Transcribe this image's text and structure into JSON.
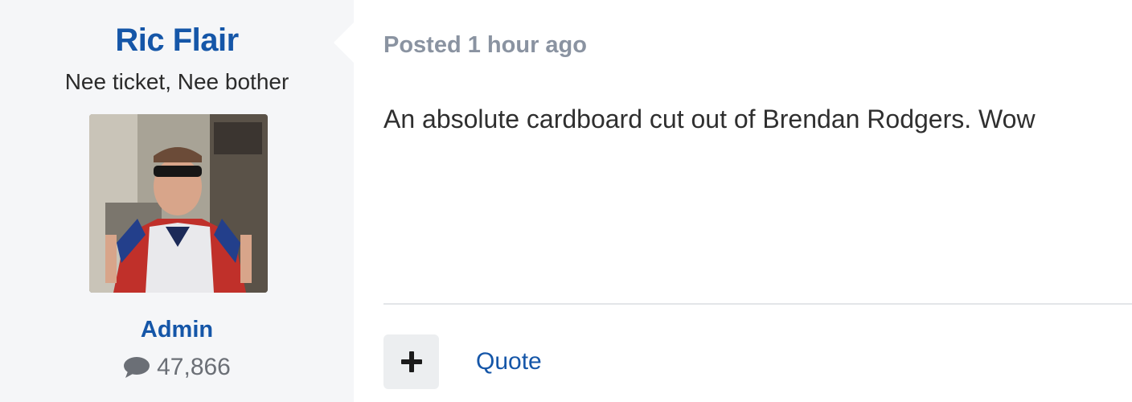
{
  "author": {
    "name": "Ric Flair",
    "title": "Nee ticket, Nee bother",
    "group": "Admin",
    "post_count": "47,866",
    "post_count_icon": "comment-icon",
    "avatar_icon": "user-avatar-photo"
  },
  "post": {
    "meta": "Posted 1 hour ago",
    "content": "An absolute cardboard cut out of Brendan Rodgers. Wow"
  },
  "actions": {
    "multiquote_icon": "plus-icon",
    "quote_label": "Quote"
  },
  "colors": {
    "link": "#1556a8",
    "meta": "#8a93a1",
    "panel_bg": "#f5f6f8"
  }
}
